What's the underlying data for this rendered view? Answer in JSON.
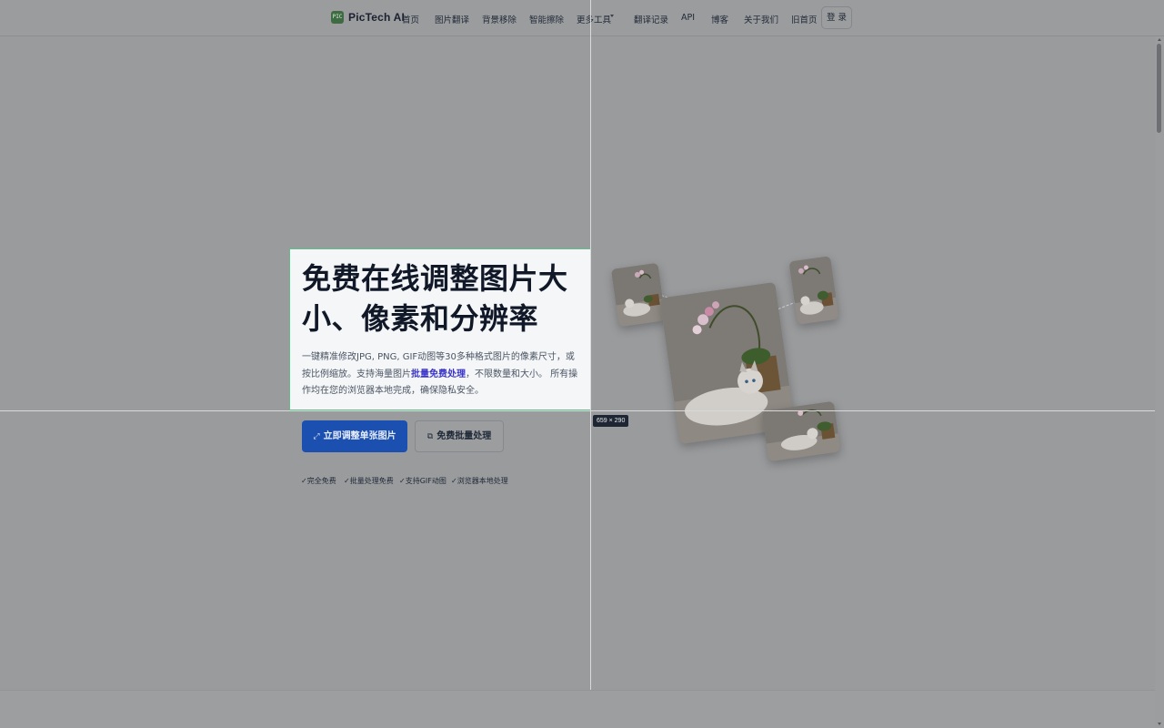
{
  "header": {
    "logo_icon_text": "PIC",
    "brand": "PicTech AI",
    "nav": [
      "首页",
      "图片翻译",
      "背景移除",
      "智能擦除",
      "更多工具",
      "翻译记录",
      "API",
      "博客",
      "关于我们",
      "旧首页"
    ],
    "login": "登 录"
  },
  "hero": {
    "title": "免费在线调整图片大小、像素和分辨率",
    "desc_before": "一键精准修改JPG, PNG, GIF动图等30多种格式图片的像素尺寸，或按比例缩放。支持海量图片",
    "desc_highlight": "批量免费处理",
    "desc_after": "，不限数量和大小。 所有操作均在您的浏览器本地完成，确保隐私安全。",
    "dimension_badge": "659 × 290"
  },
  "actions": {
    "primary_icon": "⤢",
    "primary": "立即调整单张图片",
    "secondary_icon": "⧉",
    "secondary": "免费批量处理"
  },
  "features": [
    "✓完全免费",
    "✓批量处理免费",
    "✓支持GIF动图",
    "✓浏览器本地处理"
  ],
  "colors": {
    "overlay_bg": "#9a9b9d",
    "primary_button": "#1b4fb0",
    "highlight_text": "#3b36c9",
    "selection_border": "#5fbe8a"
  }
}
